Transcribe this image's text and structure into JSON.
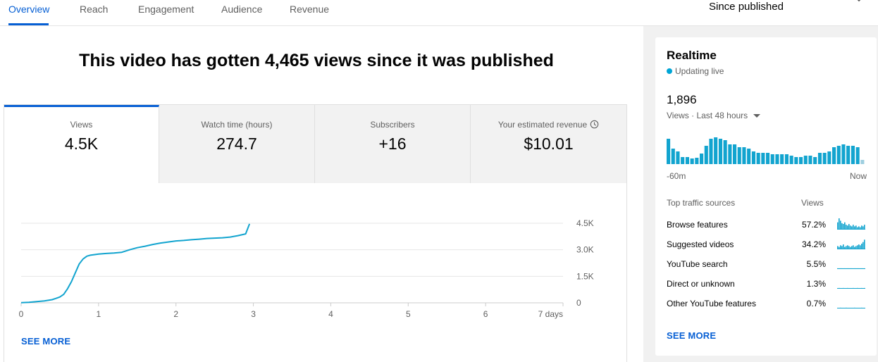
{
  "tabs": [
    {
      "label": "Overview",
      "active": true
    },
    {
      "label": "Reach",
      "active": false
    },
    {
      "label": "Engagement",
      "active": false
    },
    {
      "label": "Audience",
      "active": false
    },
    {
      "label": "Revenue",
      "active": false
    }
  ],
  "period": {
    "label": "Since published"
  },
  "headline": "This video has gotten 4,465 views since it was published",
  "metrics": [
    {
      "label": "Views",
      "value": "4.5K"
    },
    {
      "label": "Watch time (hours)",
      "value": "274.7"
    },
    {
      "label": "Subscribers",
      "value": "+16"
    },
    {
      "label": "Your estimated revenue",
      "value": "$10.01"
    }
  ],
  "chart_data": {
    "type": "line",
    "xlabel": "",
    "ylabel": "",
    "x_ticks": [
      "0",
      "1",
      "2",
      "3",
      "4",
      "5",
      "6",
      "7 days"
    ],
    "y_ticks": [
      "0",
      "1.5K",
      "3.0K",
      "4.5K"
    ],
    "xlim": [
      0,
      7
    ],
    "ylim": [
      0,
      4500
    ],
    "grid": true,
    "color": "#12a4cf",
    "series": [
      {
        "x": [
          0,
          0.1,
          0.2,
          0.3,
          0.4,
          0.45,
          0.5,
          0.55,
          0.6,
          0.65,
          0.7,
          0.75,
          0.8,
          0.85,
          0.9,
          1.0,
          1.1,
          1.2,
          1.3,
          1.4,
          1.5,
          1.6,
          1.7,
          1.8,
          1.9,
          2.0,
          2.1,
          2.2,
          2.3,
          2.4,
          2.5,
          2.6,
          2.7,
          2.8,
          2.9,
          2.95
        ],
        "y": [
          10,
          30,
          70,
          110,
          180,
          250,
          330,
          480,
          800,
          1200,
          1700,
          2200,
          2480,
          2640,
          2700,
          2760,
          2790,
          2820,
          2860,
          3000,
          3120,
          3200,
          3300,
          3380,
          3440,
          3500,
          3530,
          3570,
          3600,
          3640,
          3660,
          3680,
          3720,
          3800,
          3900,
          4465
        ]
      }
    ]
  },
  "see_more_left": "SEE MORE",
  "realtime": {
    "title": "Realtime",
    "status": "Updating live",
    "count": "1,896",
    "subtitle": "Views · Last 48 hours",
    "bars": [
      36,
      22,
      18,
      10,
      10,
      8,
      9,
      15,
      26,
      36,
      38,
      36,
      34,
      28,
      28,
      24,
      24,
      22,
      18,
      16,
      16,
      16,
      14,
      14,
      14,
      14,
      12,
      10,
      10,
      12,
      12,
      10,
      16,
      16,
      18,
      24,
      26,
      28,
      26,
      26,
      24,
      6
    ],
    "x_start": "-60m",
    "x_end": "Now",
    "sources_header": "Top traffic sources",
    "views_header": "Views",
    "sources": [
      {
        "name": "Browse features",
        "pct": "57.2%",
        "spark": [
          9,
          14,
          11,
          8,
          7,
          9,
          6,
          5,
          7,
          5,
          4,
          6,
          4,
          5,
          3,
          4,
          3,
          5,
          4,
          6
        ]
      },
      {
        "name": "Suggested videos",
        "pct": "34.2%",
        "spark": [
          4,
          3,
          5,
          4,
          6,
          3,
          4,
          5,
          4,
          3,
          4,
          5,
          3,
          4,
          5,
          6,
          5,
          7,
          9,
          12
        ]
      },
      {
        "name": "YouTube search",
        "pct": "5.5%",
        "spark": [
          1,
          1,
          1,
          1,
          1,
          1,
          1,
          1,
          1,
          1,
          1,
          1,
          1,
          1,
          1,
          1,
          1,
          1,
          1,
          1
        ]
      },
      {
        "name": "Direct or unknown",
        "pct": "1.3%",
        "spark": [
          0,
          1,
          0,
          0,
          1,
          0,
          0,
          1,
          0,
          0,
          0,
          1,
          0,
          0,
          1,
          0,
          0,
          1,
          0,
          1
        ]
      },
      {
        "name": "Other YouTube features",
        "pct": "0.7%",
        "spark": [
          0,
          0,
          1,
          0,
          0,
          0,
          1,
          0,
          0,
          0,
          0,
          0,
          1,
          0,
          0,
          0,
          0,
          1,
          0,
          0
        ]
      }
    ],
    "see_more": "SEE MORE"
  }
}
